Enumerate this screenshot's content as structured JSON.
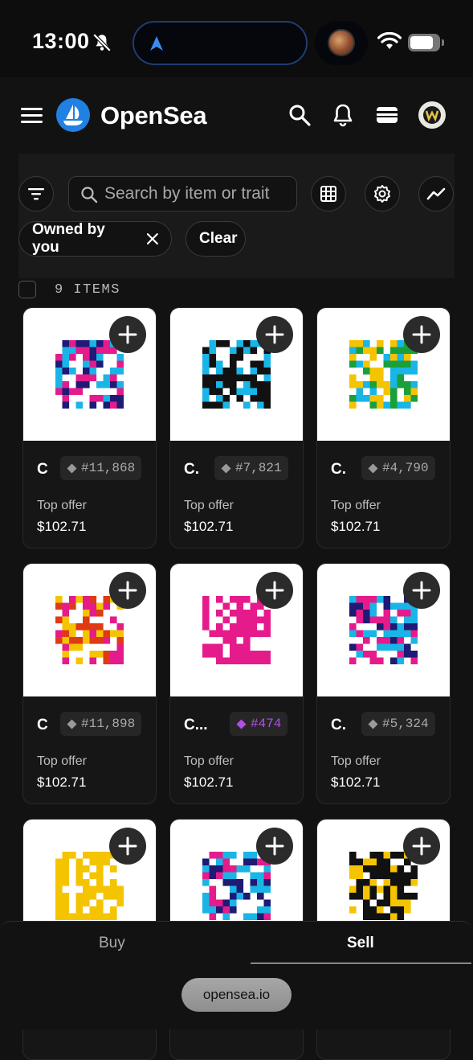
{
  "status_bar": {
    "time": "13:00"
  },
  "header": {
    "brand": "OpenSea"
  },
  "search": {
    "placeholder": "Search by item or trait"
  },
  "filters": {
    "chip_label": "Owned by you",
    "clear_label": "Clear"
  },
  "results": {
    "count_label": "9 ITEMS"
  },
  "items": [
    {
      "name": "C",
      "token": "#11,868",
      "offer_label": "Top offer",
      "offer_value": "$102.71"
    },
    {
      "name": "C.",
      "token": "#7,821",
      "offer_label": "Top offer",
      "offer_value": "$102.71"
    },
    {
      "name": "C.",
      "token": "#4,790",
      "offer_label": "Top offer",
      "offer_value": "$102.71"
    },
    {
      "name": "C",
      "token": "#11,898",
      "offer_label": "Top offer",
      "offer_value": "$102.71"
    },
    {
      "name": "C...",
      "token": "#474",
      "offer_label": "Top offer",
      "offer_value": "$102.71"
    },
    {
      "name": "C.",
      "token": "#5,324",
      "offer_label": "Top offer",
      "offer_value": "$102.71"
    },
    {
      "name": "",
      "token": "",
      "offer_label": "",
      "offer_value": ""
    },
    {
      "name": "",
      "token": "",
      "offer_label": "",
      "offer_value": ""
    },
    {
      "name": "",
      "token": "",
      "offer_label": "",
      "offer_value": ""
    }
  ],
  "bottom_tabs": {
    "buy": "Buy",
    "sell": "Sell"
  },
  "browser": {
    "url": "opensea.io"
  },
  "colors": {
    "accent_blue": "#2081e2",
    "rarity_purple": "#b34ee8",
    "background": "#121212"
  }
}
